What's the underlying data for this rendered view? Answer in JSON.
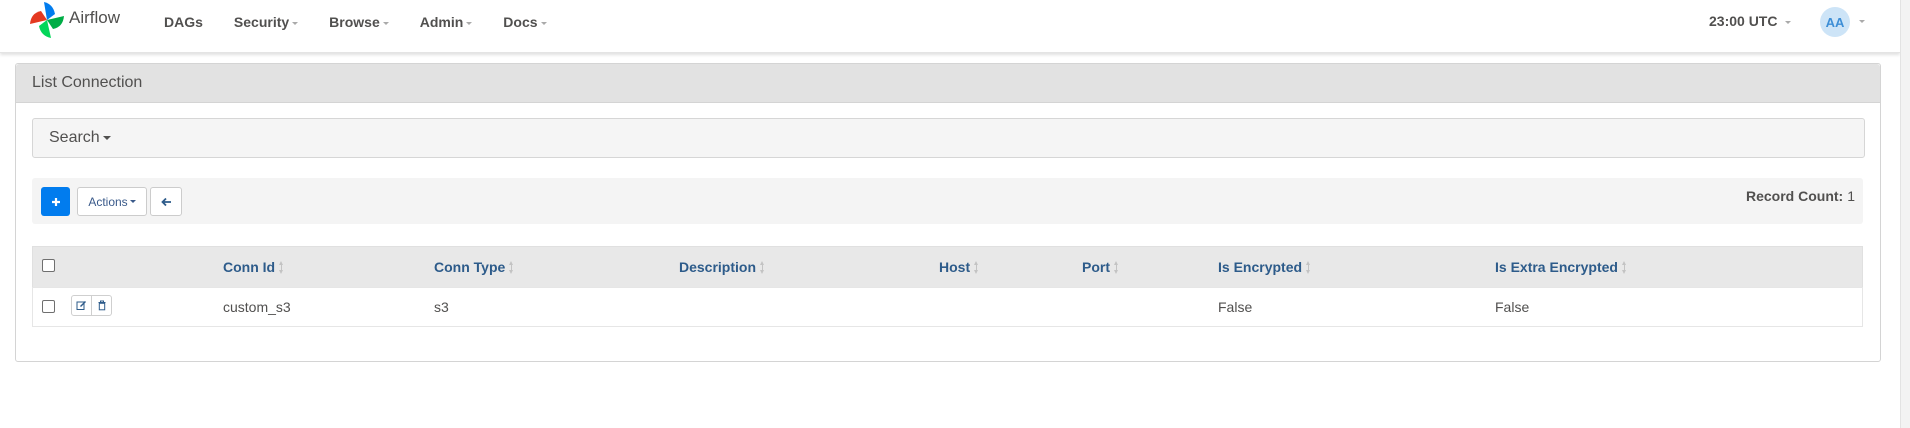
{
  "navbar": {
    "brand": "Airflow",
    "menu": [
      {
        "label": "DAGs",
        "has_caret": false
      },
      {
        "label": "Security",
        "has_caret": true
      },
      {
        "label": "Browse",
        "has_caret": true
      },
      {
        "label": "Admin",
        "has_caret": true
      },
      {
        "label": "Docs",
        "has_caret": true
      }
    ],
    "clock": "23:00 UTC",
    "user_initials": "AA"
  },
  "panel": {
    "title": "List Connection",
    "search_label": "Search",
    "toolbar": {
      "actions_label": "Actions",
      "record_count_label": "Record Count:",
      "record_count_value": "1"
    },
    "table": {
      "columns": [
        "Conn Id",
        "Conn Type",
        "Description",
        "Host",
        "Port",
        "Is Encrypted",
        "Is Extra Encrypted"
      ],
      "rows": [
        {
          "conn_id": "custom_s3",
          "conn_type": "s3",
          "description": "",
          "host": "",
          "port": "",
          "is_encrypted": "False",
          "is_extra_encrypted": "False"
        }
      ]
    }
  },
  "colors": {
    "primary": "#017cee",
    "header_link": "#2d5b8a",
    "text": "#51504f"
  },
  "icons": {
    "add": "plus-icon",
    "back": "arrow-left-icon",
    "edit": "edit-icon",
    "delete": "trash-icon"
  }
}
